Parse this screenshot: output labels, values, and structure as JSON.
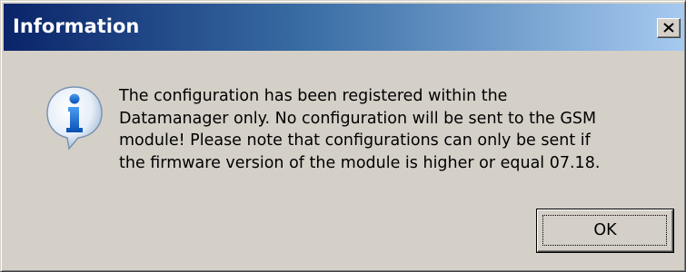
{
  "dialog": {
    "title": "Information",
    "close_icon": "close-icon",
    "icon": "info-icon",
    "message": "The configuration has been registered within the\nDatamanager only. No configuration will be sent to the GSM\nmodule! Please note that configurations can only be sent if\nthe firmware version of the module is higher or equal 07.18.",
    "ok_label": "OK"
  },
  "colors": {
    "titlebar_start": "#0a246a",
    "titlebar_end": "#a6caf0",
    "dialog_background": "#d4d0c8",
    "info_icon_blue": "#1f6fd0"
  }
}
